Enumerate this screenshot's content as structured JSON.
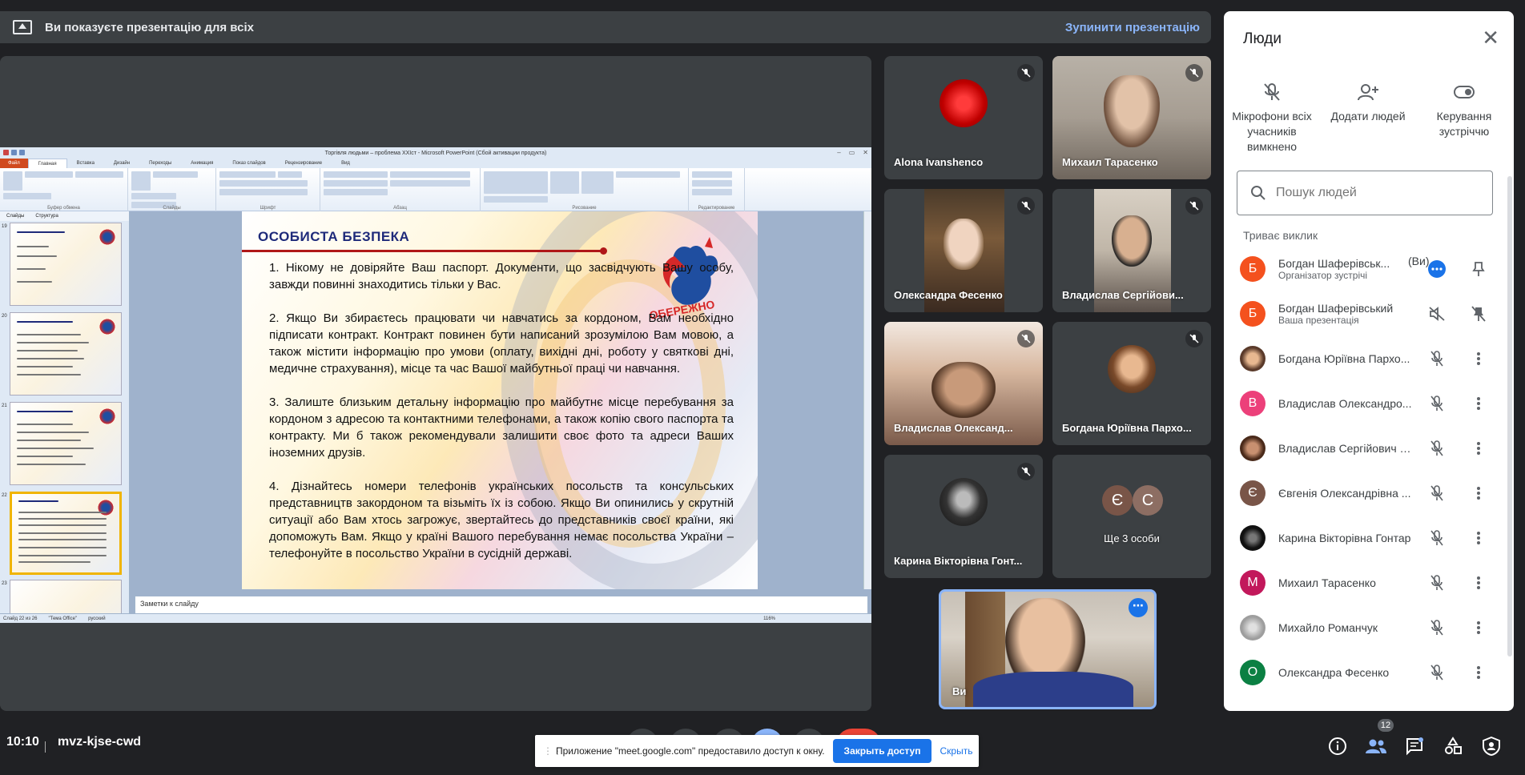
{
  "banner": {
    "text": "Ви показуєте презентацію для всіх",
    "stop": "Зупинити презентацію"
  },
  "ppt": {
    "title": "Торгівля людьми – проблема XXIст - Microsoft PowerPoint (Сбой активации продукта)",
    "tabs": [
      "Файл",
      "Главная",
      "Вставка",
      "Дизайн",
      "Переходы",
      "Анимация",
      "Показ слайдов",
      "Рецензирование",
      "Вид"
    ],
    "ribbon_groups": [
      "Буфер обмена",
      "Слайды",
      "Шрифт",
      "Абзац",
      "Рисование",
      "Редактирование"
    ],
    "thumb_tabs": [
      "Слайды",
      "Структура"
    ],
    "thumb_numbers": [
      "19",
      "20",
      "21",
      "22",
      "23"
    ],
    "notes_placeholder": "Заметки к слайду",
    "status": [
      "Слайд 22 из 26",
      "\"Тема Office\"",
      "русский"
    ],
    "zoom": "116%",
    "slide": {
      "title": "ОСОБИСТА БЕЗПЕКА",
      "logo_text": "ОБЕРЕЖНО",
      "items": [
        "1.   Нікому не довіряйте Ваш паспорт. Документи, що засвідчують Вашу особу, завжди повинні знаходитись тільки у Вас.",
        "2.  Якщо Ви збираєтесь працювати чи навчатись за кордоном, Вам необхідно підписати контракт. Контракт повинен бути написаний зрозумілою Вам мовою, а також містити інформацію про умови (оплату, вихідні дні, роботу у святкові дні, медичне страхування), місце та час Вашої майбутньої праці чи навчання.",
        "3.  Залиште близьким детальну інформацію про майбутнє місце перебування за кордоном з адресою та контактними телефонами, а також копію свого паспорта та контракту. Ми б також рекомендували залишити своє фото та адреси Ваших іноземних друзів.",
        "4.   Дізнайтесь номери телефонів українських посольств та консульських представництв закордоном та візьміть їх із собою. Якщо Ви опинились у скрутній ситуації або Вам хтось загрожує, звертайтесь до представників своєї країни, які допоможуть Вам. Якщо у країні Вашого перебування немає посольства України – телефонуйте в посольство України в сусідній державі."
      ]
    }
  },
  "tiles": [
    {
      "name": "Alona Ivanshenco"
    },
    {
      "name": "Михаил Тарасенко"
    },
    {
      "name": "Олександра Фесенко"
    },
    {
      "name": "Владислав Сергійови..."
    },
    {
      "name": "Владислав Олександ..."
    },
    {
      "name": "Богдана Юріївна Пархо..."
    },
    {
      "name": "Карина Вікторівна Гонт..."
    },
    {
      "name": "Ще 3 особи",
      "avatars": [
        "Є",
        "С"
      ]
    }
  ],
  "self_view": {
    "name": "Ви"
  },
  "people": {
    "title": "Люди",
    "actions": [
      {
        "label": "Мікрофони всіх учасників вимкнено"
      },
      {
        "label": "Додати людей"
      },
      {
        "label": "Керування зустріччю"
      }
    ],
    "search_placeholder": "Пошук людей",
    "section": "Триває виклик",
    "participants": [
      {
        "initial": "Б",
        "name": "Богдан Шаферівськ...",
        "you": "(Ви)",
        "sub": "Організатор зустрічі",
        "color": "#f4511e"
      },
      {
        "initial": "Б",
        "name": "Богдан Шаферівський",
        "sub": "Ваша презентація",
        "color": "#f4511e"
      },
      {
        "initial": "",
        "name": "Богдана Юріївна Пархо...",
        "color": "#5a3a2a"
      },
      {
        "initial": "В",
        "name": "Владислав Олександро...",
        "color": "#ec407a"
      },
      {
        "initial": "",
        "name": "Владислав Сергійович Б...",
        "color": "#6d4c41"
      },
      {
        "initial": "Є",
        "name": "Євгенія Олександрівна ...",
        "color": "#795548"
      },
      {
        "initial": "",
        "name": "Карина Вікторівна Гонтар",
        "color": "#222222"
      },
      {
        "initial": "М",
        "name": "Михаил Тарасенко",
        "color": "#c2185b"
      },
      {
        "initial": "",
        "name": "Михайло Романчук",
        "color": "#bdbdbd"
      },
      {
        "initial": "О",
        "name": "Олександра Фесенко",
        "color": "#0b8043"
      }
    ]
  },
  "bottom": {
    "time": "10:10",
    "meeting_code": "mvz-kjse-cwd",
    "people_count": "12"
  },
  "notice": {
    "message": "Приложение \"meet.google.com\" предоставило доступ к окну.",
    "close_access": "Закрыть доступ",
    "hide": "Скрыть"
  }
}
